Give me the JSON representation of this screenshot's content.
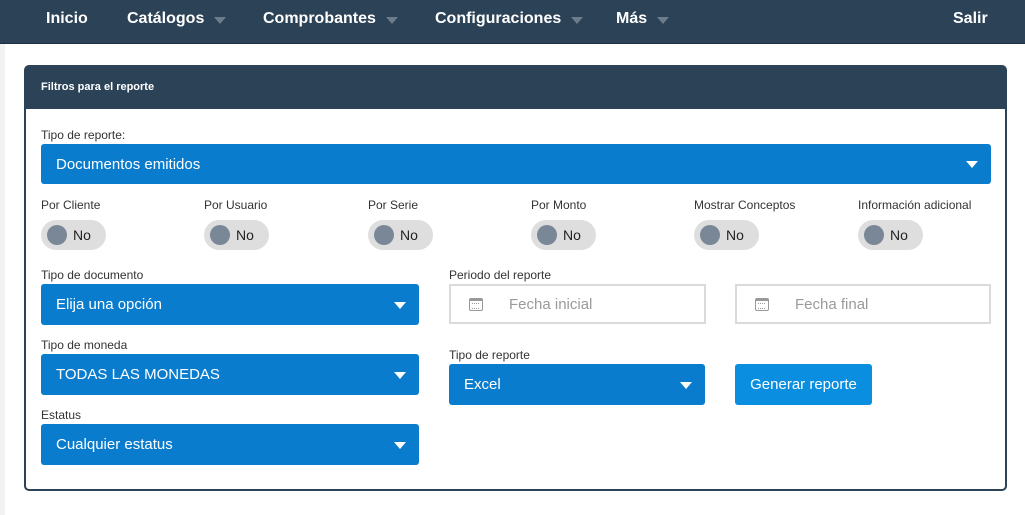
{
  "nav": {
    "inicio": "Inicio",
    "catalogos": "Catálogos",
    "comprobantes": "Comprobantes",
    "configuraciones": "Configuraciones",
    "mas": "Más",
    "salir": "Salir"
  },
  "panel": {
    "title": "Filtros para el reporte"
  },
  "tipo_reporte": {
    "label": "Tipo de reporte:",
    "value": "Documentos emitidos"
  },
  "toggles": [
    {
      "label": "Por Cliente",
      "state": "No"
    },
    {
      "label": "Por Usuario",
      "state": "No"
    },
    {
      "label": "Por Serie",
      "state": "No"
    },
    {
      "label": "Por Monto",
      "state": "No"
    },
    {
      "label": "Mostrar Conceptos",
      "state": "No"
    },
    {
      "label": "Información adicional",
      "state": "No"
    }
  ],
  "tipo_documento": {
    "label": "Tipo de documento",
    "value": "Elija una opción"
  },
  "periodo": {
    "label": "Periodo del reporte",
    "start_placeholder": "Fecha inicial",
    "end_placeholder": "Fecha final"
  },
  "tipo_moneda": {
    "label": "Tipo de moneda",
    "value": "TODAS LAS MONEDAS"
  },
  "formato": {
    "label": "Tipo de reporte",
    "value": "Excel"
  },
  "estatus": {
    "label": "Estatus",
    "value": "Cualquier estatus"
  },
  "generar": {
    "label": "Generar reporte"
  },
  "colors": {
    "nav_bg": "#2c4257",
    "select_bg": "#0a7ccd",
    "button_bg": "#0a8ee0",
    "toggle_bg": "#dedede"
  }
}
